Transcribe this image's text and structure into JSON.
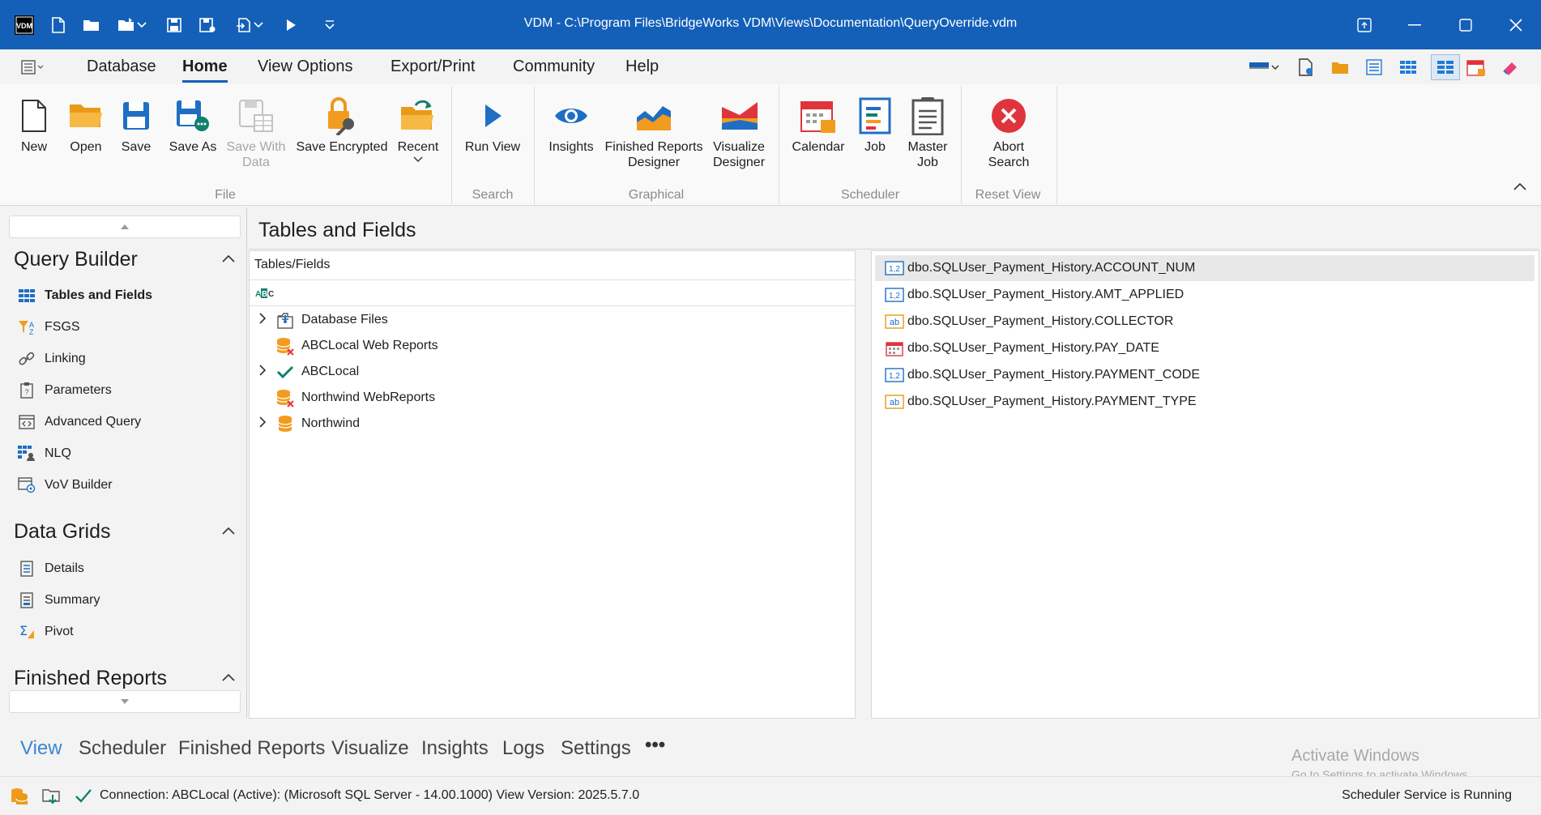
{
  "titlebar": {
    "title": "VDM - C:\\Program Files\\BridgeWorks VDM\\Views\\Documentation\\QueryOverride.vdm",
    "app_icon": "vdm-logo"
  },
  "menu": {
    "tabs": [
      "Database",
      "Home",
      "View Options",
      "Export/Print",
      "Community",
      "Help"
    ],
    "active": "Home"
  },
  "ribbon": {
    "file": {
      "label": "File",
      "new": "New",
      "open": "Open",
      "save": "Save",
      "save_as": "Save As",
      "save_with_data_1": "Save With",
      "save_with_data_2": "Data",
      "save_encrypted": "Save Encrypted",
      "recent": "Recent"
    },
    "search": {
      "label": "Search",
      "run_view": "Run View"
    },
    "graphical": {
      "label": "Graphical",
      "insights": "Insights",
      "finished_reports_1": "Finished Reports",
      "finished_reports_2": "Designer",
      "visualize_1": "Visualize",
      "visualize_2": "Designer"
    },
    "scheduler": {
      "label": "Scheduler",
      "calendar": "Calendar",
      "job": "Job",
      "master_job_1": "Master",
      "master_job_2": "Job"
    },
    "reset_view": {
      "label": "Reset View",
      "abort_1": "Abort",
      "abort_2": "Search"
    }
  },
  "leftnav": {
    "query_builder": {
      "title": "Query Builder",
      "items": [
        "Tables and Fields",
        "FSGS",
        "Linking",
        "Parameters",
        "Advanced Query",
        "NLQ",
        "VoV Builder"
      ]
    },
    "data_grids": {
      "title": "Data Grids",
      "items": [
        "Details",
        "Summary",
        "Pivot"
      ]
    },
    "finished_reports": {
      "title": "Finished Reports"
    }
  },
  "content": {
    "title": "Tables and Fields",
    "tree": {
      "column": "Tables/Fields",
      "rows": [
        {
          "label": "Database Files",
          "expandable": true,
          "icon": "database-files-icon"
        },
        {
          "label": "ABCLocal Web Reports",
          "expandable": false,
          "icon": "database-error-icon"
        },
        {
          "label": "ABCLocal",
          "expandable": true,
          "icon": "check-icon"
        },
        {
          "label": "Northwind WebReports",
          "expandable": false,
          "icon": "database-error-icon"
        },
        {
          "label": "Northwind",
          "expandable": true,
          "icon": "database-icon"
        }
      ]
    },
    "fields": [
      {
        "label": "dbo.SQLUser_Payment_History.ACCOUNT_NUM",
        "type": "numeric"
      },
      {
        "label": "dbo.SQLUser_Payment_History.AMT_APPLIED",
        "type": "numeric"
      },
      {
        "label": "dbo.SQLUser_Payment_History.COLLECTOR",
        "type": "text"
      },
      {
        "label": "dbo.SQLUser_Payment_History.PAY_DATE",
        "type": "date"
      },
      {
        "label": "dbo.SQLUser_Payment_History.PAYMENT_CODE",
        "type": "numeric"
      },
      {
        "label": "dbo.SQLUser_Payment_History.PAYMENT_TYPE",
        "type": "text"
      }
    ]
  },
  "bottom_tabs": {
    "items": [
      "View",
      "Scheduler",
      "Finished Reports",
      "Visualize",
      "Insights",
      "Logs",
      "Settings"
    ],
    "more": "•••",
    "active": "View"
  },
  "status": {
    "connection": "Connection: ABCLocal (Active): (Microsoft SQL Server - 14.00.1000) View Version: 2025.5.7.0",
    "scheduler": "Scheduler Service is Running"
  },
  "watermark": {
    "line1": "Activate Windows",
    "line2": "Go to Settings to activate Windows."
  },
  "colors": {
    "titlebar": "#1460b8",
    "accent": "#1460b8",
    "orange": "#f29c1f",
    "red": "#e0343c",
    "green": "#13806e"
  }
}
